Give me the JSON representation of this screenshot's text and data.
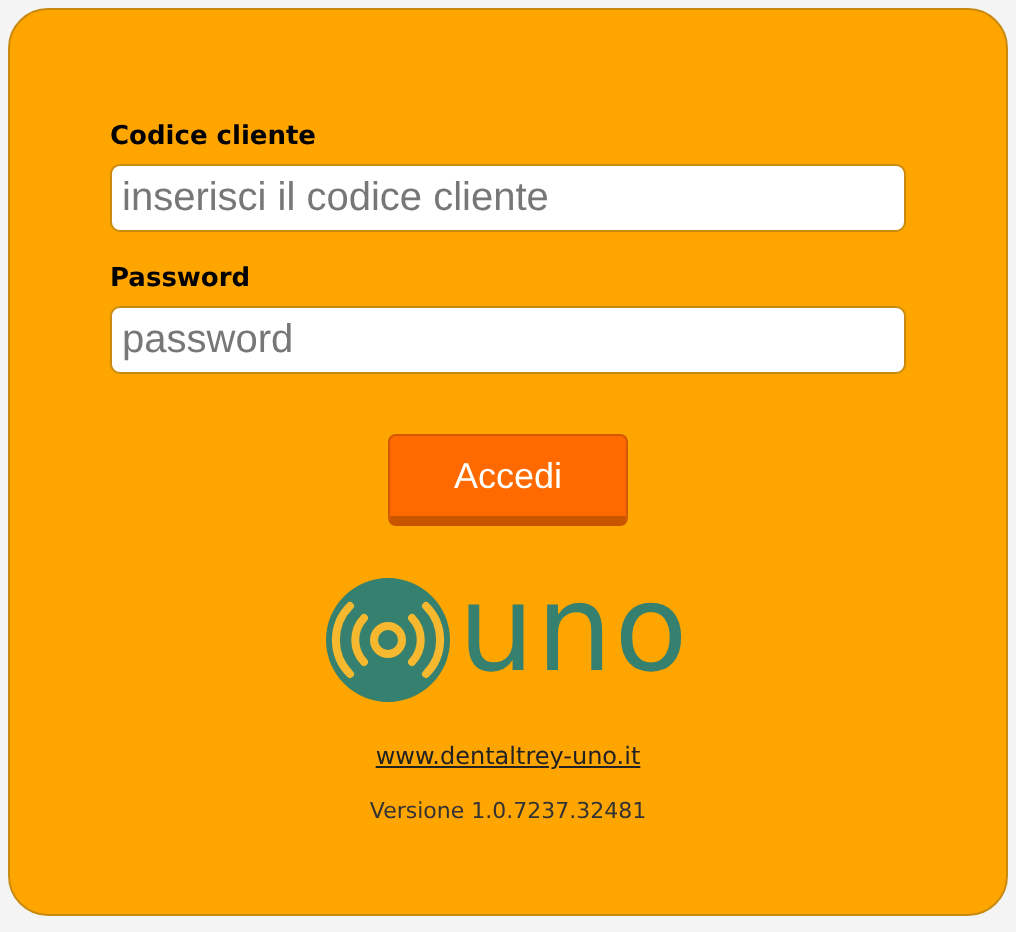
{
  "fields": [
    {
      "label": "Codice cliente",
      "placeholder": "inserisci il codice cliente"
    },
    {
      "label": "Password",
      "placeholder": "password"
    }
  ],
  "button": "Accedi",
  "logo": {
    "text": "uno"
  },
  "link": "www.dentaltrey-uno.it",
  "version": "Versione 1.0.7237.32481"
}
